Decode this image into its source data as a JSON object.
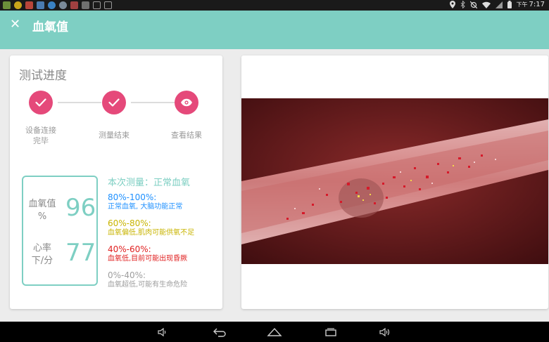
{
  "status_bar": {
    "time": "7:17",
    "ampm": "下午",
    "icons": [
      "app-icon",
      "sun-icon",
      "mail-icon",
      "image-icon",
      "browser-icon",
      "globe-icon",
      "gallery-icon",
      "app-icon",
      "usb-icon",
      "usb-debug-icon",
      "location-icon",
      "bluetooth-icon",
      "alarm-off-icon",
      "wifi-icon",
      "signal-icon",
      "battery-icon"
    ]
  },
  "header": {
    "close_icon": "close-icon",
    "title": "血氧值",
    "color": "#7ecfc3"
  },
  "progress": {
    "title": "测试进度",
    "steps": [
      {
        "label_line1": "设备连接",
        "label_line2": "完毕",
        "icon": "check-icon"
      },
      {
        "label_line1": "测量结束",
        "label_line2": "",
        "icon": "check-icon"
      },
      {
        "label_line1": "查看结果",
        "label_line2": "",
        "icon": "eye-icon"
      }
    ],
    "accent": "#e5497a"
  },
  "metrics": {
    "spo2_label_line1": "血氧值",
    "spo2_label_line2": "%",
    "spo2_value": "96",
    "hr_label_line1": "心率",
    "hr_label_line2": "下/分",
    "hr_value": "77"
  },
  "legend": {
    "headline": "本次测量：正常血氧",
    "items": [
      {
        "range": "80%-100%:",
        "desc": "正常血氧, 大脑功能正常",
        "color": "#1e90ff"
      },
      {
        "range": "60%-80%:",
        "desc": "血氧偏低,肌肉可能供氧不足",
        "color": "#c8b400"
      },
      {
        "range": "40%-60%:",
        "desc": "血氧低,目前可能出现昏厥",
        "color": "#e02020"
      },
      {
        "range": "0%-40%:",
        "desc": "血氧超低,可能有生命危险",
        "color": "#9e9e9e"
      }
    ]
  },
  "nav": {
    "icons": [
      "volume-down-icon",
      "back-icon",
      "home-icon",
      "recent-apps-icon",
      "volume-up-icon"
    ]
  }
}
